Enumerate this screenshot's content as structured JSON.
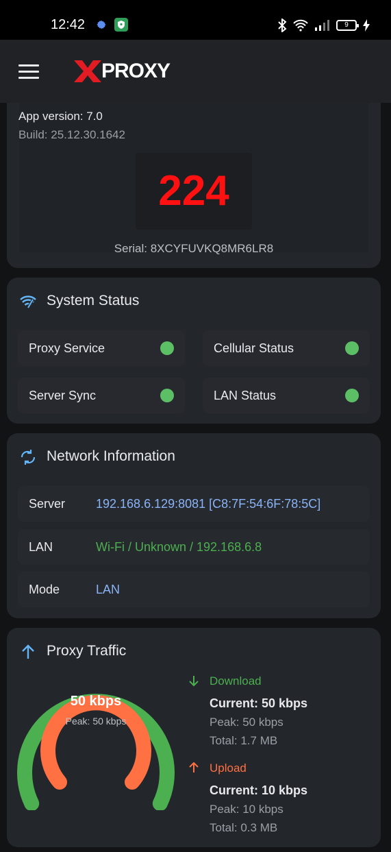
{
  "status_bar": {
    "time": "12:42",
    "battery": "9"
  },
  "app_bar": {
    "logo_text": "PROXY"
  },
  "info": {
    "app_version": "App version: 7.0",
    "build": "Build: 25.12.30.1642",
    "counter": "224",
    "serial": "Serial: 8XCYFUVKQ8MR6LR8"
  },
  "system_status": {
    "title": "System Status",
    "items": [
      {
        "label": "Proxy Service",
        "status_color": "#5cbf66"
      },
      {
        "label": "Cellular Status",
        "status_color": "#5cbf66"
      },
      {
        "label": "Server Sync",
        "status_color": "#5cbf66"
      },
      {
        "label": "LAN Status",
        "status_color": "#5cbf66"
      }
    ]
  },
  "network": {
    "title": "Network Information",
    "rows": [
      {
        "label": "Server",
        "value": "192.168.6.129:8081 [C8:7F:54:6F:78:5C]",
        "color": "#8ab4f8"
      },
      {
        "label": "LAN",
        "value": "Wi-Fi / Unknown / 192.168.6.8",
        "color": "#4caf50"
      },
      {
        "label": "Mode",
        "value": "LAN",
        "color": "#8ab4f8"
      }
    ]
  },
  "traffic": {
    "title": "Proxy Traffic",
    "gauge": {
      "value": "50 kbps",
      "peak": "Peak: 50 kbps"
    },
    "download": {
      "label": "Download",
      "current": "Current: 50 kbps",
      "peak": "Peak: 50 kbps",
      "total": "Total: 1.7 MB",
      "color": "#4caf50"
    },
    "upload": {
      "label": "Upload",
      "current": "Current: 10 kbps",
      "peak": "Peak: 10 kbps",
      "total": "Total: 0.3 MB",
      "color": "#ff7043"
    }
  },
  "colors": {
    "accent": "#64b5f6",
    "counter": "#ff1111"
  }
}
